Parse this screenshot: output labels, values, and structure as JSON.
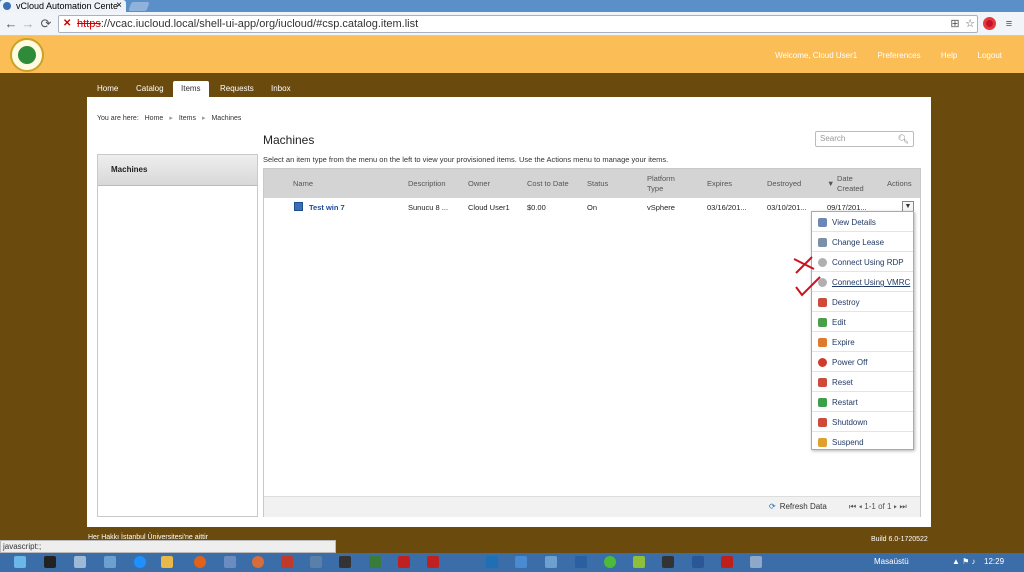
{
  "browser": {
    "tab_title": "vCloud Automation Cente",
    "tab_close": "×",
    "url_scheme": "https",
    "url_rest": "://vcac.iucloud.local/shell-ui-app/org/iucloud/#csp.catalog.item.list",
    "back_glyph": "←",
    "forward_glyph": "→",
    "reload_glyph": "⟳"
  },
  "header": {
    "links": [
      "Welcome, Cloud User1",
      "Preferences",
      "Help",
      "Logout"
    ]
  },
  "tabs": [
    "Home",
    "Catalog",
    "Items",
    "Requests",
    "Inbox"
  ],
  "active_tab": "Items",
  "breadcrumb": {
    "prefix": "You are here:",
    "items": [
      "Home",
      "Items",
      "Machines"
    ]
  },
  "sidebar": {
    "items": [
      "Machines"
    ]
  },
  "main": {
    "title": "Machines",
    "instructions": "Select an item type from the menu on the left to view your provisioned items. Use the Actions menu to manage your items.",
    "search_placeholder": "Search"
  },
  "table": {
    "columns": [
      "Name",
      "Description",
      "Owner",
      "Cost to Date",
      "Status",
      "Platform Type",
      "Expires",
      "Destroyed",
      "Date Created",
      "Actions"
    ],
    "rows": [
      {
        "name": "Test win 7",
        "description": "Sunucu 8 ...",
        "owner": "Cloud User1",
        "cost": "$0.00",
        "status": "On",
        "platform": "vSphere",
        "expires": "03/16/201...",
        "destroyed": "03/10/201...",
        "created": "09/17/201..."
      }
    ],
    "refresh_label": "Refresh Data",
    "pager": "1-1 of 1"
  },
  "actions_menu": [
    {
      "label": "View Details",
      "color": "#6b86b8"
    },
    {
      "label": "Change Lease",
      "color": "#7a8fa8"
    },
    {
      "label": "Connect Using RDP",
      "color": "#b0b0b0"
    },
    {
      "label": "Connect Using VMRC",
      "color": "#b0b0b0"
    },
    {
      "label": "Destroy",
      "color": "#d04a3a"
    },
    {
      "label": "Edit",
      "color": "#4aa04a"
    },
    {
      "label": "Expire",
      "color": "#e07a2a"
    },
    {
      "label": "Power Off",
      "color": "#d0392b"
    },
    {
      "label": "Reset",
      "color": "#d04a3a"
    },
    {
      "label": "Restart",
      "color": "#3aa04a"
    },
    {
      "label": "Shutdown",
      "color": "#d04a3a"
    },
    {
      "label": "Suspend",
      "color": "#e0a030"
    }
  ],
  "footer": {
    "copyright": "Her Hakkı İstanbul Üniversitesi'ne aittir",
    "build": "Build 6.0-1720522",
    "status_url": "javascript:;"
  },
  "taskbar": {
    "locale": "Masaüstü",
    "time": "12:29"
  }
}
